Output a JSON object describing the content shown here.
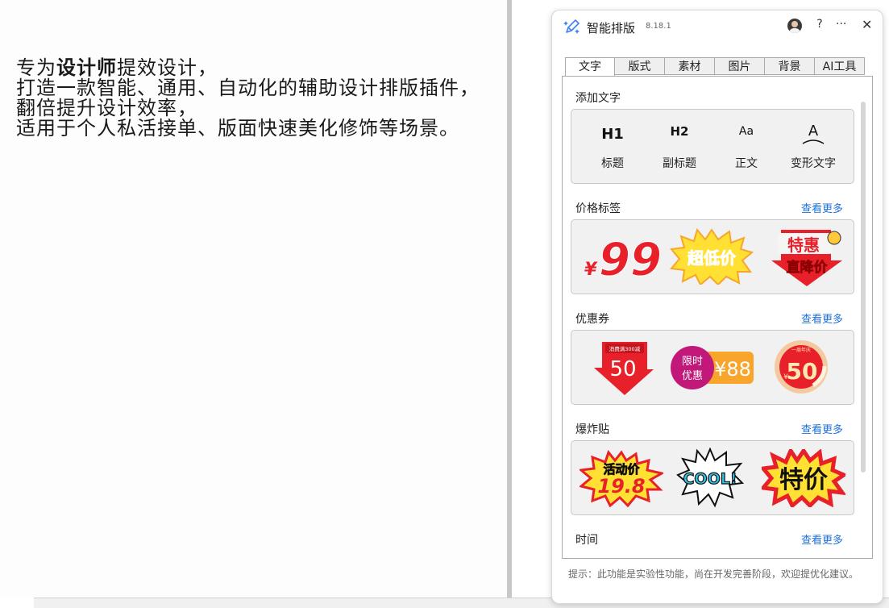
{
  "canvas": {
    "lines": [
      {
        "pre": "专为",
        "bold": "设计师",
        "post": "提效设计，"
      },
      {
        "pre": "打造一款智能、通用、自动化的辅助设计排版插件，",
        "bold": "",
        "post": ""
      },
      {
        "pre": "翻倍提升设计效率，",
        "bold": "",
        "post": ""
      },
      {
        "pre": "适用于个人私活接单、版面快速美化修饰等场景。",
        "bold": "",
        "post": ""
      }
    ]
  },
  "panel": {
    "title": "智能排版",
    "version": "8.18.1",
    "help_label": "?",
    "more_label": "···",
    "close_label": "✕",
    "tabs": [
      "文字",
      "版式",
      "素材",
      "图片",
      "背景",
      "AI工具"
    ],
    "active_tab": 0,
    "sections": {
      "add_text": {
        "title": "添加文字",
        "items": [
          {
            "glyph": "H1",
            "label": "标题"
          },
          {
            "glyph": "H2",
            "label": "副标题"
          },
          {
            "glyph": "Aa",
            "label": "正文"
          },
          {
            "glyph": "A",
            "label": "变形文字"
          }
        ]
      },
      "price_tags": {
        "title": "价格标签",
        "more": "查看更多",
        "stickers": [
          {
            "text1": "¥99"
          },
          {
            "text1": "超低价"
          },
          {
            "text1": "特惠",
            "text2": "直降价"
          }
        ]
      },
      "coupons": {
        "title": "优惠券",
        "more": "查看更多",
        "stickers": [
          {
            "text1": "消费满300减",
            "text2": "50"
          },
          {
            "text1": "限时",
            "text2": "优惠",
            "text3": "¥88"
          },
          {
            "text1": "一周年庆",
            "text2": "50",
            "text3": "¥"
          }
        ]
      },
      "burst": {
        "title": "爆炸贴",
        "more": "查看更多",
        "stickers": [
          {
            "text1": "活动价",
            "text2": "19.8"
          },
          {
            "text1": "COOL!"
          },
          {
            "text1": "特价"
          }
        ]
      },
      "time": {
        "title": "时间",
        "more": "查看更多"
      }
    },
    "tip": "提示：此功能是实验性功能，尚在开发完善阶段，欢迎提优化建议。"
  },
  "colors": {
    "accent_link": "#1e6fd9",
    "sticker_red": "#e8202a",
    "sticker_yellow": "#ffe033",
    "sticker_orange": "#f7a52b",
    "sticker_magenta": "#c2187a"
  }
}
